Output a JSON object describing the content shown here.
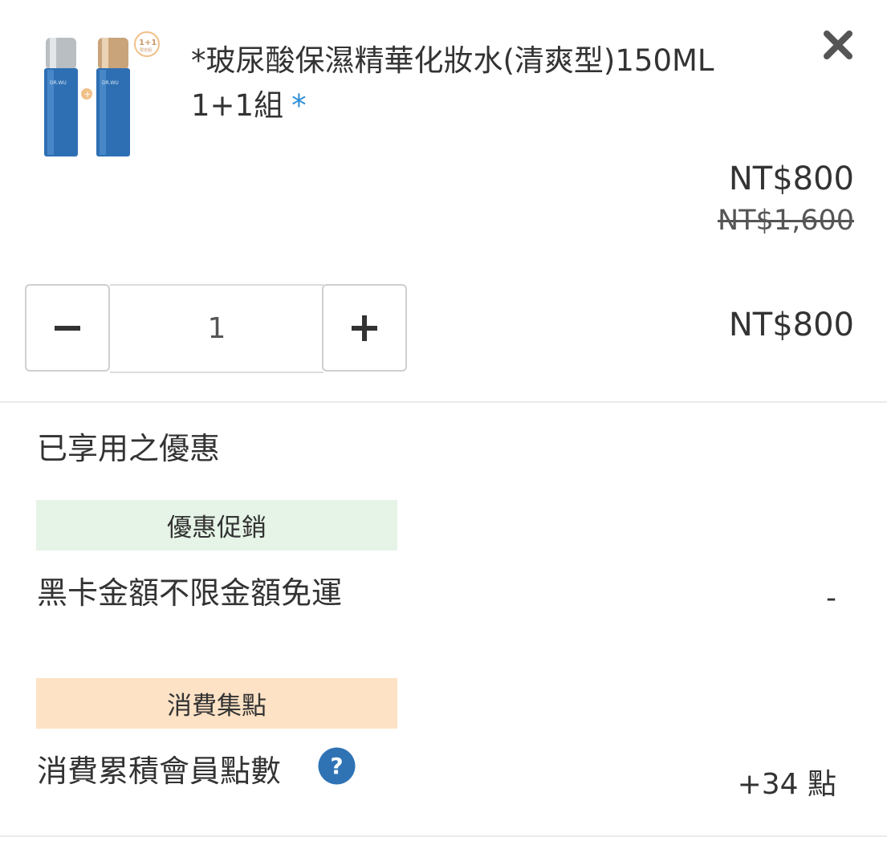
{
  "product": {
    "title": "*玻尿酸保濕精華化妝水(清爽型)150ML 1+1組",
    "required_mark": "*",
    "image_icon": "product-bottles-image",
    "image_badge": "1+1",
    "image_badge_sub": "限定組",
    "bottle_brand": "DR.WU",
    "sale_price": "NT$800",
    "original_price": "NT$1,600"
  },
  "quantity": {
    "value": "1",
    "minus_icon": "minus-icon",
    "plus_icon": "plus-icon"
  },
  "line_total": "NT$800",
  "offers": {
    "section_title": "已享用之優惠",
    "promotion": {
      "tag": "優惠促銷",
      "name": "黑卡金額不限金額免運",
      "value": "-"
    },
    "points": {
      "tag": "消費集點",
      "name": "消費累積會員點數",
      "value": "+34 點"
    }
  },
  "colors": {
    "accent_blue": "#2f8fd8",
    "promo_green_bg": "#e6f4e7",
    "points_orange_bg": "#fde2c6",
    "text": "#333333"
  }
}
